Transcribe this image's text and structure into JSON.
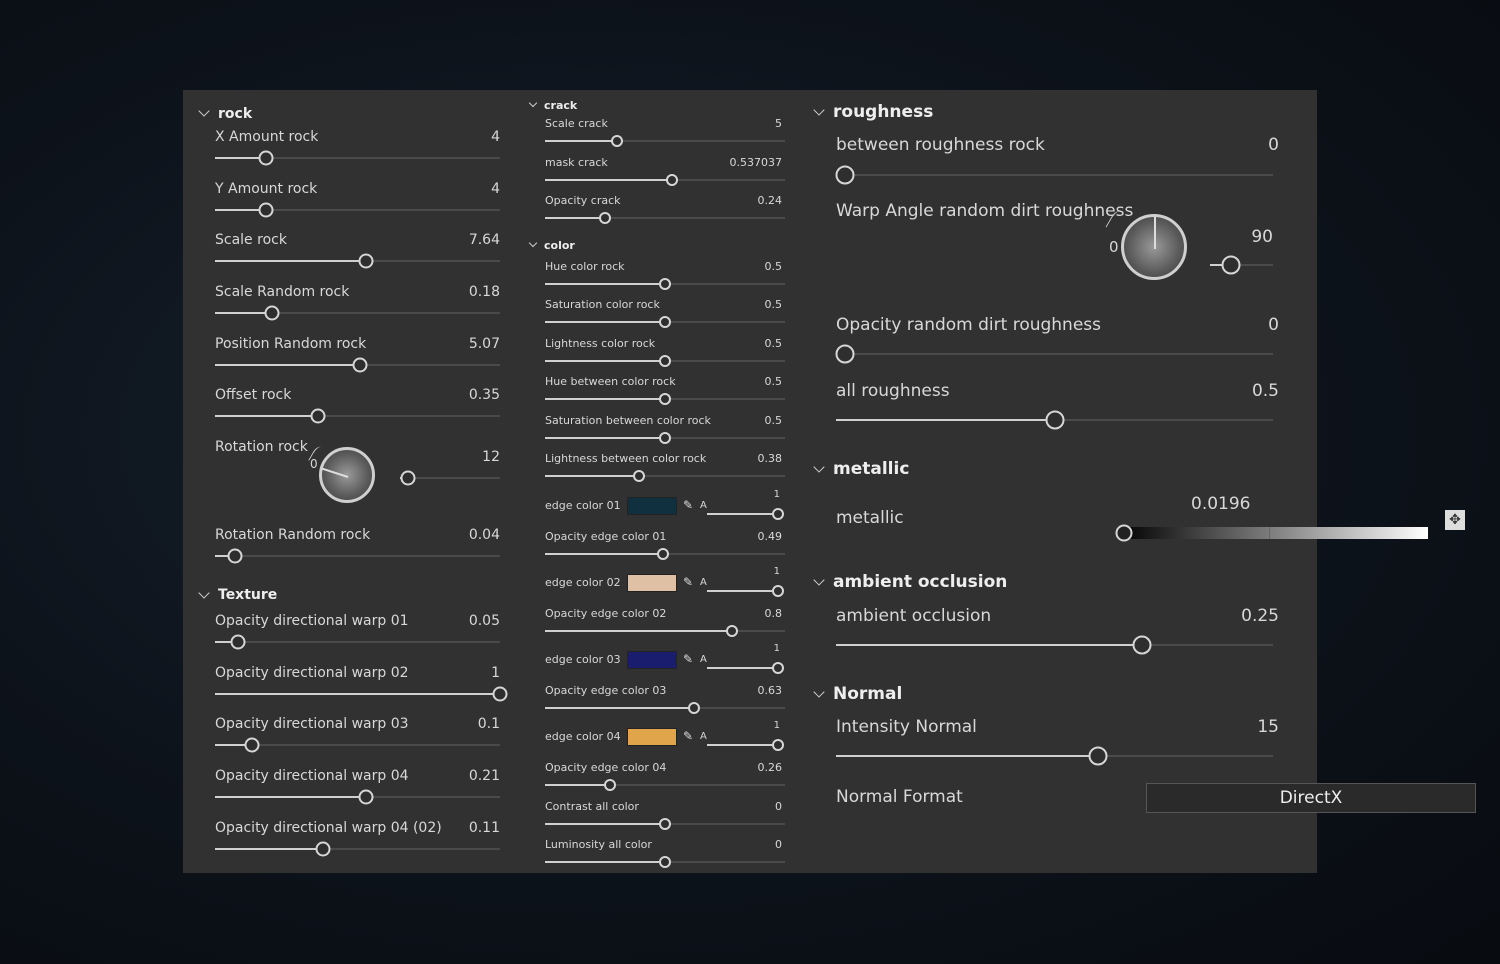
{
  "col1": {
    "rock": {
      "title": "rock",
      "items": [
        {
          "label": "X Amount rock",
          "value": "4",
          "fraction": 0.18
        },
        {
          "label": "Y Amount rock",
          "value": "4",
          "fraction": 0.18
        },
        {
          "label": "Scale rock",
          "value": "7.64",
          "fraction": 0.53
        },
        {
          "label": "Scale Random rock",
          "value": "0.18",
          "fraction": 0.2
        },
        {
          "label": "Position Random rock",
          "value": "5.07",
          "fraction": 0.51
        },
        {
          "label": "Offset rock",
          "value": "0.35",
          "fraction": 0.36
        }
      ],
      "rotation": {
        "label": "Rotation rock",
        "value": "12",
        "dial_zero": "0",
        "fraction": 0.08
      },
      "rotation_random": {
        "label": "Rotation Random rock",
        "value": "0.04",
        "fraction": 0.07
      }
    },
    "texture": {
      "title": "Texture",
      "items": [
        {
          "label": "Opacity directional warp 01",
          "value": "0.05",
          "fraction": 0.08
        },
        {
          "label": "Opacity directional warp 02",
          "value": "1",
          "fraction": 1
        },
        {
          "label": "Opacity directional warp 03",
          "value": "0.1",
          "fraction": 0.13
        },
        {
          "label": "Opacity directional warp 04",
          "value": "0.21",
          "fraction": 0.53
        },
        {
          "label": "Opacity directional warp 04 (02)",
          "value": "0.11",
          "fraction": 0.38
        }
      ]
    }
  },
  "col2": {
    "crack": {
      "title": "crack",
      "items": [
        {
          "label": "Scale crack",
          "value": "5",
          "fraction": 0.3
        },
        {
          "label": "mask crack",
          "value": "0.537037",
          "fraction": 0.53
        },
        {
          "label": "Opacity crack",
          "value": "0.24",
          "fraction": 0.25
        }
      ]
    },
    "color": {
      "title": "color",
      "items": [
        {
          "label": "Hue color rock",
          "value": "0.5",
          "fraction": 0.5
        },
        {
          "label": "Saturation color rock",
          "value": "0.5",
          "fraction": 0.5
        },
        {
          "label": "Lightness color rock",
          "value": "0.5",
          "fraction": 0.5
        },
        {
          "label": "Hue between color rock",
          "value": "0.5",
          "fraction": 0.5
        },
        {
          "label": "Saturation between color rock",
          "value": "0.5",
          "fraction": 0.5
        },
        {
          "label": "Lightness between color rock",
          "value": "0.38",
          "fraction": 0.39
        }
      ],
      "edges": [
        {
          "label": "edge color 01",
          "color": "#10303f",
          "alpha_label": "A",
          "alpha": "1",
          "op_label": "Opacity edge color 01",
          "op_value": "0.49",
          "op_fraction": 0.49
        },
        {
          "label": "edge color 02",
          "color": "#e0c0a4",
          "alpha_label": "A",
          "alpha": "1",
          "op_label": "Opacity edge color 02",
          "op_value": "0.8",
          "op_fraction": 0.78
        },
        {
          "label": "edge color 03",
          "color": "#1a1d6e",
          "alpha_label": "A",
          "alpha": "1",
          "op_label": "Opacity edge color 03",
          "op_value": "0.63",
          "op_fraction": 0.62
        },
        {
          "label": "edge color 04",
          "color": "#e0a44a",
          "alpha_label": "A",
          "alpha": "1",
          "op_label": "Opacity edge color 04",
          "op_value": "0.26",
          "op_fraction": 0.27
        }
      ],
      "tail": [
        {
          "label": "Contrast all color",
          "value": "0",
          "fraction": 0.5
        },
        {
          "label": "Luminosity all color",
          "value": "0",
          "fraction": 0.5
        }
      ]
    }
  },
  "col3": {
    "roughness": {
      "title": "roughness",
      "between": {
        "label": "between roughness rock",
        "value": "0",
        "fraction": 0.02
      },
      "warp": {
        "label": "Warp Angle random dirt roughness",
        "value": "90",
        "dial_zero": "0",
        "fraction": 0.33
      },
      "opacity": {
        "label": "Opacity random dirt roughness",
        "value": "0",
        "fraction": 0.02
      },
      "all": {
        "label": "all roughness",
        "value": "0.5",
        "fraction": 0.5
      }
    },
    "metallic": {
      "title": "metallic",
      "label": "metallic",
      "value": "0.0196",
      "fraction": 0.0196
    },
    "ao": {
      "title": "ambient occlusion",
      "label": "ambient occlusion",
      "value": "0.25",
      "fraction": 0.7
    },
    "normal": {
      "title": "Normal",
      "intensity_label": "Intensity Normal",
      "intensity_value": "15",
      "fraction": 0.6,
      "format_label": "Normal Format",
      "format_value": "DirectX"
    }
  }
}
